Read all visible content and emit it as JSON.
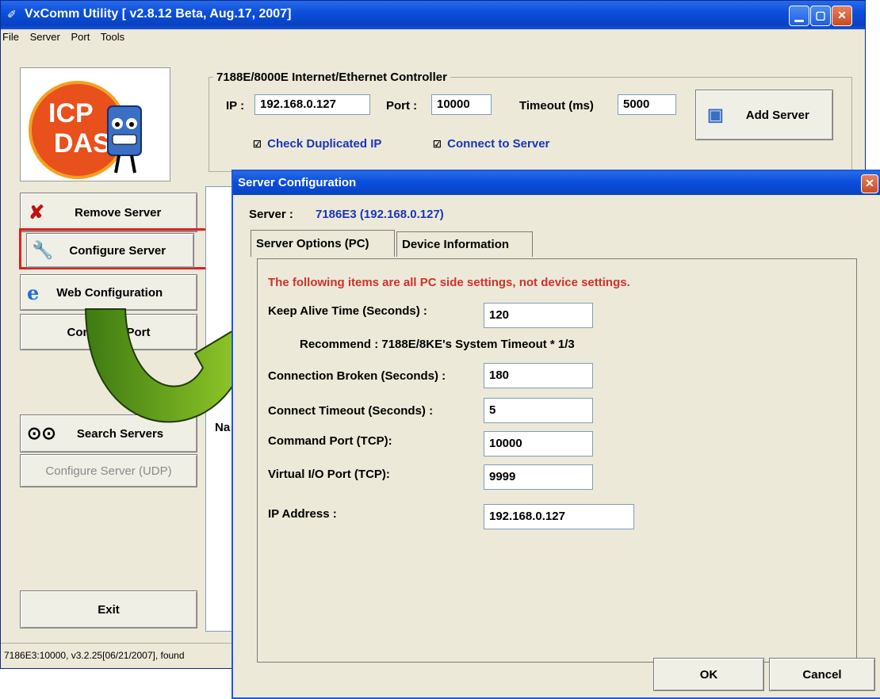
{
  "main_window": {
    "title": "VxComm Utility [ v2.8.12 Beta, Aug.17, 2007]",
    "menu": [
      "File",
      "Server",
      "Port",
      "Tools"
    ],
    "logo_text": "ICP DAS",
    "group_title": "7188E/8000E Internet/Ethernet Controller",
    "ip_label": "IP :",
    "ip_value": "192.168.0.127",
    "port_label": "Port :",
    "port_value": "10000",
    "timeout_label": "Timeout (ms)",
    "timeout_value": "5000",
    "add_server": "Add Server",
    "check_duplicated_ip": "Check Duplicated IP",
    "connect_to_server": "Connect to Server",
    "remove_server": "Remove Server",
    "configure_server": "Configure Server",
    "web_configuration": "Web Configuration",
    "configure_port": "Configure Port",
    "search_servers": "Search Servers",
    "configure_server_udp": "Configure Server (UDP)",
    "exit": "Exit",
    "list_header": "Na",
    "status": "7186E3:10000, v3.2.25[06/21/2007], found"
  },
  "dialog": {
    "title": "Server Configuration",
    "server_label": "Server :",
    "server_value": "7186E3 (192.168.0.127)",
    "tabs": [
      "Server Options (PC)",
      "Device Information"
    ],
    "notice": "The following items are all PC side settings, not device settings.",
    "fields": [
      {
        "label": "Keep Alive Time (Seconds) :",
        "value": "120"
      },
      {
        "label": "Connection Broken (Seconds) :",
        "value": "180"
      },
      {
        "label": "Connect Timeout (Seconds) :",
        "value": "5"
      },
      {
        "label": "Command Port (TCP):",
        "value": "10000"
      },
      {
        "label": "Virtual I/O Port (TCP):",
        "value": "9999"
      },
      {
        "label": "IP Address :",
        "value": "192.168.0.127"
      }
    ],
    "recommend": "Recommend : 7188E/8KE's System Timeout * 1/3",
    "ok": "OK",
    "cancel": "Cancel"
  },
  "colors": {
    "title_bar": "#0b4fdc",
    "notice_red": "#d0312d",
    "link_blue": "#1a35b8",
    "highlight_red": "#e02020",
    "arrow_green": "#7cc21a"
  }
}
